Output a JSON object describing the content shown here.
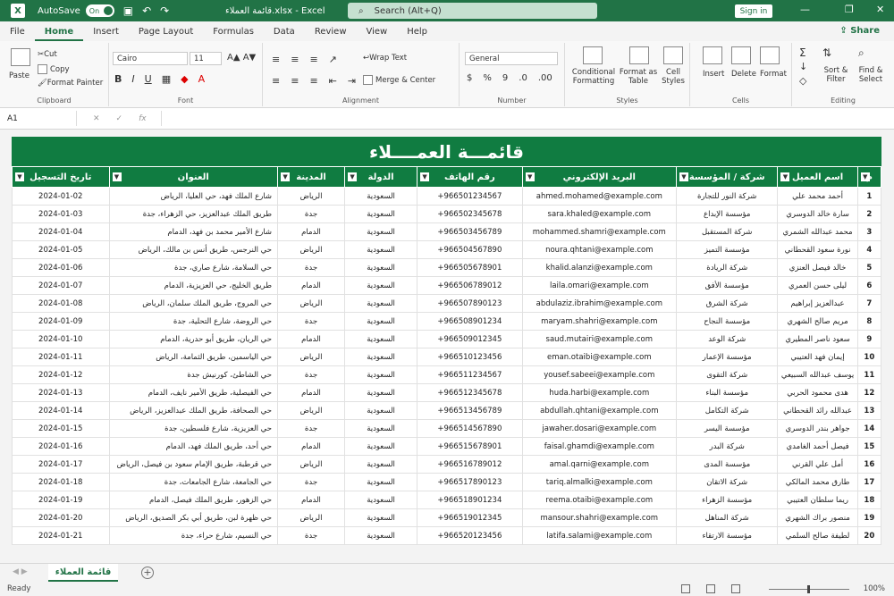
{
  "titlebar": {
    "autosave_label": "AutoSave",
    "autosave_state": "On",
    "doc_title": "قائمة العملاء.xlsx  -  Excel",
    "search_placeholder": "Search (Alt+Q)",
    "signin_label": "Sign in"
  },
  "menu": {
    "items": [
      "File",
      "Home",
      "Insert",
      "Page Layout",
      "Formulas",
      "Data",
      "Review",
      "View",
      "Help"
    ],
    "share_label": "Share"
  },
  "ribbon": {
    "clipboard": {
      "paste": "Paste",
      "cut": "Cut",
      "copy": "Copy",
      "format_painter": "Format Painter",
      "label": "Clipboard"
    },
    "font": {
      "name": "Cairo",
      "size": "11",
      "label": "Font"
    },
    "alignment": {
      "wrap": "Wrap Text",
      "merge": "Merge & Center",
      "label": "Alignment"
    },
    "number": {
      "format": "General",
      "label": "Number"
    },
    "styles": {
      "conditional": "Conditional Formatting",
      "format_table": "Format as Table",
      "cell_styles": "Cell Styles",
      "label": "Styles"
    },
    "cells": {
      "insert": "Insert",
      "delete": "Delete",
      "format": "Format",
      "label": "Cells"
    },
    "editing": {
      "sort": "Sort & Filter",
      "find": "Find & Select",
      "label": "Editing"
    }
  },
  "formula_bar": {
    "name_box": "A1",
    "fx": "fx"
  },
  "sheet": {
    "title": "قائمـــة العمــــلاء",
    "headers": [
      "م",
      "اسم العميل",
      "شركة / المؤسسة",
      "البريد الإلكتروني",
      "رقم الهاتف",
      "الدولة",
      "المدينة",
      "العنوان",
      "تاريخ التسجيل"
    ],
    "rows": [
      [
        "1",
        "أحمد محمد علي",
        "شركة النور للتجارة",
        "ahmed.mohamed@example.com",
        "+966501234567",
        "السعودية",
        "الرياض",
        "شارع الملك فهد، حي العليا، الرياض",
        "2024-01-02"
      ],
      [
        "2",
        "سارة خالد الدوسري",
        "مؤسسة الإبداع",
        "sara.khaled@example.com",
        "+966502345678",
        "السعودية",
        "جدة",
        "طريق الملك عبدالعزيز، حي الزهراء، جدة",
        "2024-01-03"
      ],
      [
        "3",
        "محمد عبدالله الشمري",
        "شركة المستقبل",
        "mohammed.shamri@example.com",
        "+966503456789",
        "السعودية",
        "الدمام",
        "شارع الأمير محمد بن فهد، الدمام",
        "2024-01-04"
      ],
      [
        "4",
        "نورة سعود القحطاني",
        "مؤسسة التميز",
        "noura.qhtani@example.com",
        "+966504567890",
        "السعودية",
        "الرياض",
        "حي النرجس، طريق أنس بن مالك، الرياض",
        "2024-01-05"
      ],
      [
        "5",
        "خالد فيصل العنزي",
        "شركة الريادة",
        "khalid.alanzi@example.com",
        "+966505678901",
        "السعودية",
        "جدة",
        "حي السلامة، شارع صاري، جدة",
        "2024-01-06"
      ],
      [
        "6",
        "ليلى حسن العمري",
        "مؤسسة الأفق",
        "laila.omari@example.com",
        "+966506789012",
        "السعودية",
        "الدمام",
        "طريق الخليج، حي العزيزية، الدمام",
        "2024-01-07"
      ],
      [
        "7",
        "عبدالعزيز إبراهيم",
        "شركة الشرق",
        "abdulaziz.ibrahim@example.com",
        "+966507890123",
        "السعودية",
        "الرياض",
        "حي المروج، طريق الملك سلمان، الرياض",
        "2024-01-08"
      ],
      [
        "8",
        "مريم صالح الشهري",
        "مؤسسة النجاح",
        "maryam.shahri@example.com",
        "+966508901234",
        "السعودية",
        "جدة",
        "حي الروضة، شارع التحلية، جدة",
        "2024-01-09"
      ],
      [
        "9",
        "سعود ناصر المطيري",
        "شركة الوعد",
        "saud.mutairi@example.com",
        "+966509012345",
        "السعودية",
        "الدمام",
        "حي الريان، طريق أبو حدرية، الدمام",
        "2024-01-10"
      ],
      [
        "10",
        "إيمان فهد العتيبي",
        "مؤسسة الإعمار",
        "eman.otaibi@example.com",
        "+966510123456",
        "السعودية",
        "الرياض",
        "حي الياسمين، طريق الثمامة، الرياض",
        "2024-01-11"
      ],
      [
        "11",
        "يوسف عبدالله السبيعي",
        "شركة التقوى",
        "yousef.sabeei@example.com",
        "+966511234567",
        "السعودية",
        "جدة",
        "حي الشاطئ، كورنيش جدة",
        "2024-01-12"
      ],
      [
        "12",
        "هدى محمود الحربي",
        "مؤسسة البناء",
        "huda.harbi@example.com",
        "+966512345678",
        "السعودية",
        "الدمام",
        "حي الفيصلية، طريق الأمير نايف، الدمام",
        "2024-01-13"
      ],
      [
        "13",
        "عبدالله رائد القحطاني",
        "شركة التكامل",
        "abdullah.qhtani@example.com",
        "+966513456789",
        "السعودية",
        "الرياض",
        "حي الصحافة، طريق الملك عبدالعزيز، الرياض",
        "2024-01-14"
      ],
      [
        "14",
        "جواهر بندر الدوسري",
        "مؤسسة اليسر",
        "jawaher.dosari@example.com",
        "+966514567890",
        "السعودية",
        "جدة",
        "حي العزيزية، شارع فلسطين، جدة",
        "2024-01-15"
      ],
      [
        "15",
        "فيصل أحمد الغامدي",
        "شركة البدر",
        "faisal.ghamdi@example.com",
        "+966515678901",
        "السعودية",
        "الدمام",
        "حي أحد، طريق الملك فهد، الدمام",
        "2024-01-16"
      ],
      [
        "16",
        "أمل علي القرني",
        "مؤسسة المدى",
        "amal.qarni@example.com",
        "+966516789012",
        "السعودية",
        "الرياض",
        "حي قرطبة، طريق الإمام سعود بن فيصل، الرياض",
        "2024-01-17"
      ],
      [
        "17",
        "طارق محمد المالكي",
        "شركة الاتقان",
        "tariq.almalki@example.com",
        "+966517890123",
        "السعودية",
        "جدة",
        "حي الجامعة، شارع الجامعات، جدة",
        "2024-01-18"
      ],
      [
        "18",
        "ريما سلطان العتيبي",
        "مؤسسة الزهراء",
        "reema.otaibi@example.com",
        "+966518901234",
        "السعودية",
        "الدمام",
        "حي الزهور، طريق الملك فيصل، الدمام",
        "2024-01-19"
      ],
      [
        "19",
        "منصور براك الشهري",
        "شركة المناهل",
        "mansour.shahri@example.com",
        "+966519012345",
        "السعودية",
        "الرياض",
        "حي ظهرة لبن، طريق أبي بكر الصديق، الرياض",
        "2024-01-20"
      ],
      [
        "20",
        "لطيفة صالح السلمي",
        "مؤسسة الارتقاء",
        "latifa.salami@example.com",
        "+966520123456",
        "السعودية",
        "جدة",
        "حي النسيم، شارع حراء، جدة",
        "2024-01-21"
      ]
    ]
  },
  "tabs": {
    "active": "قائمة العملاء"
  },
  "status": {
    "ready": "Ready",
    "zoom": "100%"
  },
  "colors": {
    "brand": "#217346",
    "header_green": "#107c41"
  }
}
